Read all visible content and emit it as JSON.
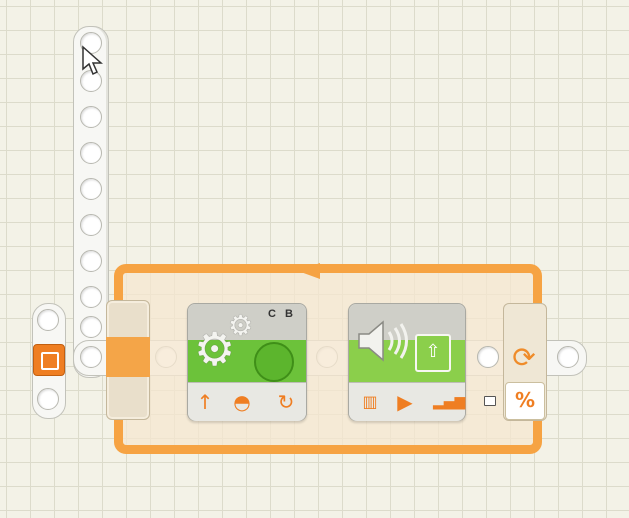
{
  "canvas": {
    "background": "#f3f2e7",
    "grid_line": "#dcdbcb"
  },
  "program": {
    "start_point": {
      "icon": "start-square-icon"
    },
    "loop": {
      "color": "#f6a343",
      "control_icon": "loop-refresh-icon",
      "count_icon": "infinity-count-icon",
      "count_glyph": "%"
    },
    "motor_block": {
      "ports": "C B",
      "color": "#6cc23a",
      "icons": [
        "gears-icon",
        "direction-up-icon",
        "speed-gauge-icon",
        "duration-rotation-icon"
      ]
    },
    "sound_block": {
      "color": "#8bcf4b",
      "icons": [
        "speaker-icon",
        "sound-file-icon",
        "sound-wave-icon",
        "play-icon",
        "volume-bars-icon"
      ]
    }
  },
  "cursor": {
    "icon": "arrow-cursor-icon"
  }
}
